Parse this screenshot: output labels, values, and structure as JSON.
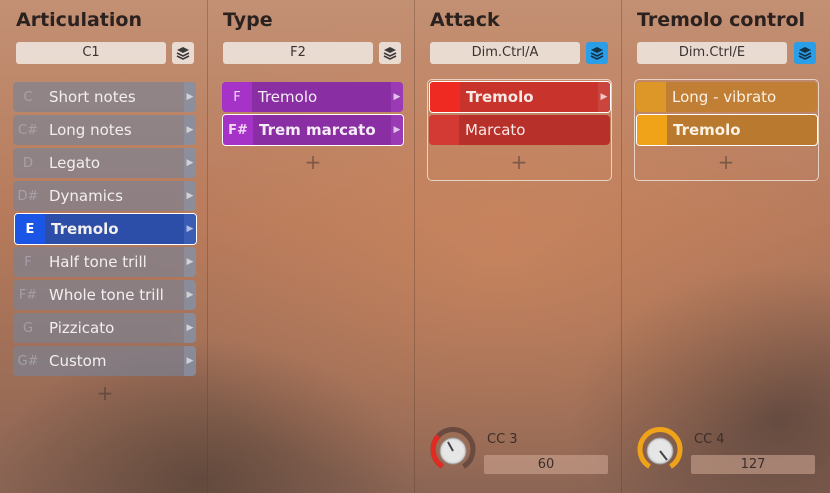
{
  "columns": {
    "articulation": {
      "title": "Articulation",
      "key": "C1",
      "layer_icon": "layers-icon",
      "items": [
        {
          "note": "C",
          "label": "Short notes"
        },
        {
          "note": "C#",
          "label": "Long notes"
        },
        {
          "note": "D",
          "label": "Legato"
        },
        {
          "note": "D#",
          "label": "Dynamics"
        },
        {
          "note": "E",
          "label": "Tremolo"
        },
        {
          "note": "F",
          "label": "Half tone trill"
        },
        {
          "note": "F#",
          "label": "Whole tone trill"
        },
        {
          "note": "G",
          "label": "Pizzicato"
        },
        {
          "note": "G#",
          "label": "Custom"
        }
      ],
      "selected_index": 4,
      "add": "+"
    },
    "type": {
      "title": "Type",
      "key": "F2",
      "layer_icon": "layers-icon",
      "items": [
        {
          "note": "F",
          "label": "Tremolo"
        },
        {
          "note": "F#",
          "label": "Trem marcato"
        }
      ],
      "selected_index": 1,
      "add": "+"
    },
    "attack": {
      "title": "Attack",
      "key": "Dim.Ctrl/A",
      "layer_icon": "layers-icon",
      "items": [
        {
          "note": "",
          "label": "Tremolo"
        },
        {
          "note": "",
          "label": "Marcato"
        }
      ],
      "selected_index": 0,
      "add": "+",
      "cc": {
        "label": "CC 3",
        "value": "60"
      }
    },
    "tremolo_control": {
      "title": "Tremolo control",
      "key": "Dim.Ctrl/E",
      "layer_icon": "layers-icon",
      "items": [
        {
          "note": "",
          "label": "Long - vibrato"
        },
        {
          "note": "",
          "label": "Tremolo"
        }
      ],
      "selected_index": 1,
      "add": "+",
      "cc": {
        "label": "CC 4",
        "value": "127"
      }
    }
  },
  "colors": {
    "articulation_selected": "#1b55e6",
    "type": "#a633c8",
    "attack": "#ee2a22",
    "tremolo_control": "#f0a318",
    "layer_button_active": "#2a9ee6"
  }
}
